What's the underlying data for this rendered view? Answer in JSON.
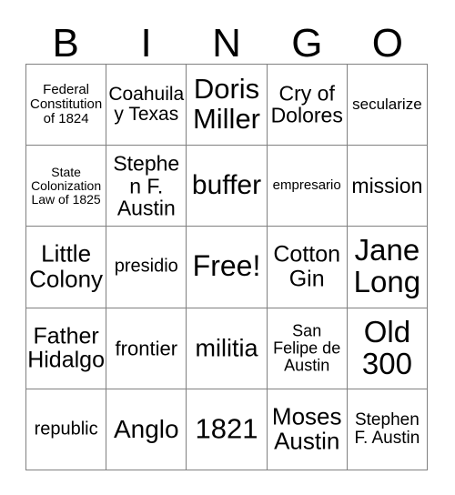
{
  "header": {
    "letters": [
      "B",
      "I",
      "N",
      "G",
      "O"
    ]
  },
  "grid": {
    "rows": 5,
    "columns": 5,
    "border_color": "#808080",
    "background_color": "#ffffff",
    "text_color": "#000000",
    "cells": [
      [
        {
          "label": "Federal Constitution of 1824",
          "font_size": 15,
          "free_space": false
        },
        {
          "label": "Coahuila y Texas",
          "font_size": 21,
          "free_space": false
        },
        {
          "label": "Doris Miller",
          "font_size": 31,
          "free_space": false
        },
        {
          "label": "Cry of Dolores",
          "font_size": 23,
          "free_space": false
        },
        {
          "label": "secularize",
          "font_size": 17,
          "free_space": false
        }
      ],
      [
        {
          "label": "State Colonization Law of 1825",
          "font_size": 14,
          "free_space": false
        },
        {
          "label": "Stephen F. Austin",
          "font_size": 23,
          "free_space": false
        },
        {
          "label": "buffer",
          "font_size": 30,
          "free_space": false
        },
        {
          "label": "empresario",
          "font_size": 15,
          "free_space": false
        },
        {
          "label": "mission",
          "font_size": 23,
          "free_space": false
        }
      ],
      [
        {
          "label": "Little Colony",
          "font_size": 26,
          "free_space": false
        },
        {
          "label": "presidio",
          "font_size": 20,
          "free_space": false
        },
        {
          "label": "Free!",
          "font_size": 32,
          "free_space": true
        },
        {
          "label": "Cotton Gin",
          "font_size": 25,
          "free_space": false
        },
        {
          "label": "Jane Long",
          "font_size": 33,
          "free_space": false
        }
      ],
      [
        {
          "label": "Father Hidalgo",
          "font_size": 25,
          "free_space": false
        },
        {
          "label": "frontier",
          "font_size": 22,
          "free_space": false
        },
        {
          "label": "militia",
          "font_size": 27,
          "free_space": false
        },
        {
          "label": "San Felipe de Austin",
          "font_size": 18,
          "free_space": false
        },
        {
          "label": "Old 300",
          "font_size": 33,
          "free_space": false
        }
      ],
      [
        {
          "label": "republic",
          "font_size": 20,
          "free_space": false
        },
        {
          "label": "Anglo",
          "font_size": 28,
          "free_space": false
        },
        {
          "label": "1821",
          "font_size": 31,
          "free_space": false
        },
        {
          "label": "Moses Austin",
          "font_size": 26,
          "free_space": false
        },
        {
          "label": "Stephen F. Austin",
          "font_size": 19,
          "free_space": false
        }
      ]
    ]
  }
}
